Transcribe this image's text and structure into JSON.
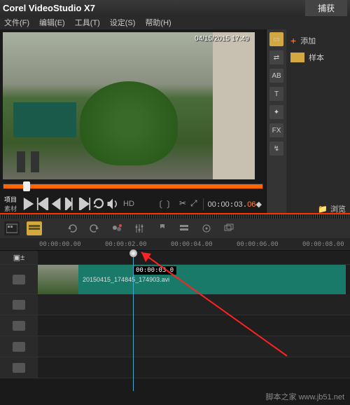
{
  "app": {
    "title": "Corel VideoStudio X7",
    "tab_capture": "捕获"
  },
  "menu": {
    "file": "文件(F)",
    "edit": "编辑(E)",
    "tools": "工具(T)",
    "settings": "设定(S)",
    "help": "帮助(H)"
  },
  "preview": {
    "timestamp": "04/15/2015 17:49"
  },
  "transport": {
    "mode_project": "项目",
    "mode_clip": "素材",
    "hd": "HD",
    "timecode": {
      "h": "00",
      "m": "00",
      "s": "03",
      "f": "06"
    },
    "tc_suffix": "◆"
  },
  "library": {
    "add": "添加",
    "sample": "样本",
    "browse": "浏览"
  },
  "timeline": {
    "clip_tc": "00:00:03 0",
    "clip_name": "20150415_174845_174903.avi",
    "ruler": [
      "00:00:00.00",
      "00:00:02.00",
      "00:00:04.00",
      "00:00:06.00",
      "00:00:08.00"
    ]
  },
  "watermark": "脚本之家 www.jb51.net"
}
